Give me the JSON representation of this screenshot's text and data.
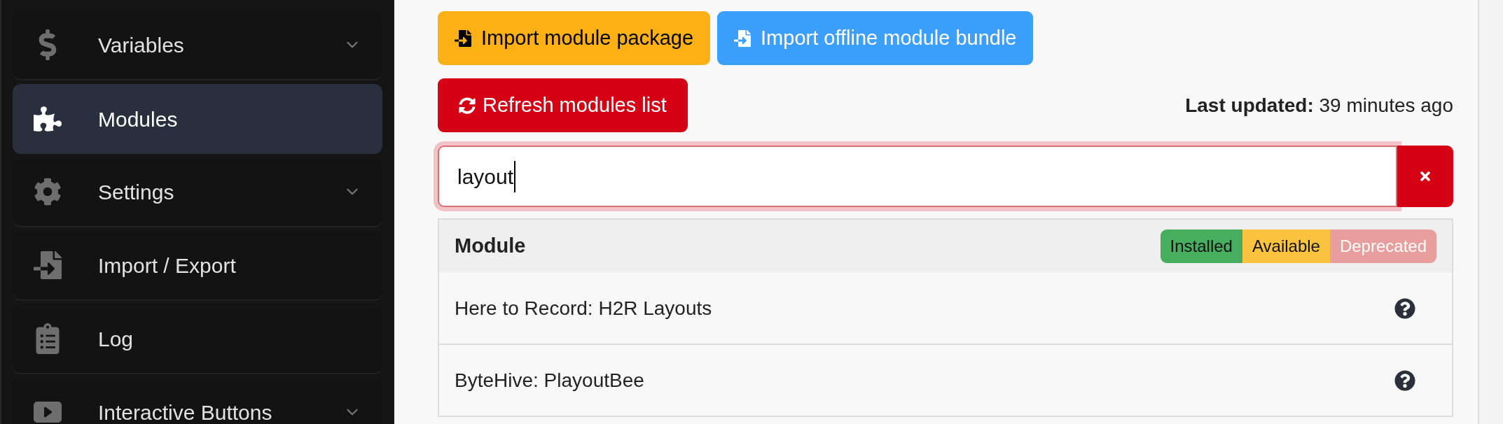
{
  "sidebar": {
    "items": [
      {
        "label": "Variables",
        "selected": false,
        "expandable": true
      },
      {
        "label": "Modules",
        "selected": true,
        "expandable": false
      },
      {
        "label": "Settings",
        "selected": false,
        "expandable": true
      },
      {
        "label": "Import / Export",
        "selected": false,
        "expandable": false
      },
      {
        "label": "Log",
        "selected": false,
        "expandable": false
      },
      {
        "label": "Interactive Buttons",
        "selected": false,
        "expandable": true
      }
    ]
  },
  "actions": [
    {
      "label": "Import module package",
      "kind": "warning"
    },
    {
      "label": "Import offline module bundle",
      "kind": "info"
    }
  ],
  "refresh_button": {
    "label": "Refresh modules list"
  },
  "last_updated": {
    "label": "Last updated:",
    "value": "39 minutes ago"
  },
  "search": {
    "value": "layout"
  },
  "table": {
    "header": "Module",
    "legend": [
      {
        "label": "Installed",
        "color": "#46ae5e"
      },
      {
        "label": "Available",
        "color": "#fbc23d"
      },
      {
        "label": "Deprecated",
        "color": "#e89e9c"
      }
    ],
    "rows": [
      {
        "name": "Here to Record: H2R Layouts"
      },
      {
        "name": "ByteHive: PlayoutBee"
      }
    ]
  }
}
